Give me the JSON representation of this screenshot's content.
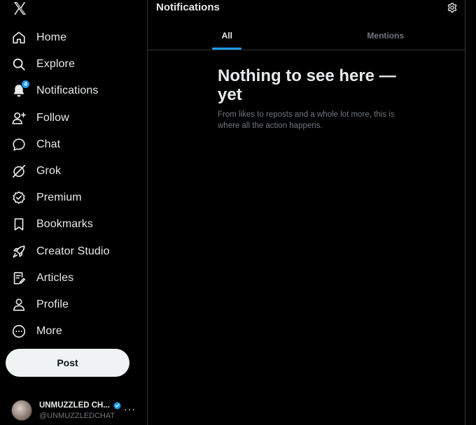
{
  "sidebar": {
    "logo_icon": "x-logo-icon",
    "items": [
      {
        "label": "Home",
        "icon": "home-icon"
      },
      {
        "label": "Explore",
        "icon": "search-icon"
      },
      {
        "label": "Notifications",
        "icon": "bell-icon",
        "badge": "4"
      },
      {
        "label": "Follow",
        "icon": "person-add-icon"
      },
      {
        "label": "Chat",
        "icon": "chat-icon"
      },
      {
        "label": "Grok",
        "icon": "grok-icon"
      },
      {
        "label": "Premium",
        "icon": "premium-icon"
      },
      {
        "label": "Bookmarks",
        "icon": "bookmark-icon"
      },
      {
        "label": "Creator Studio",
        "icon": "rocket-icon"
      },
      {
        "label": "Articles",
        "icon": "article-icon"
      },
      {
        "label": "Profile",
        "icon": "person-icon"
      },
      {
        "label": "More",
        "icon": "more-circle-icon"
      }
    ],
    "post_label": "Post",
    "account": {
      "name": "UNMUZZLED CH...",
      "handle": "@UNMUZZLEDCHAT",
      "more": "···"
    }
  },
  "main": {
    "title": "Notifications",
    "tabs": [
      {
        "label": "All",
        "active": true
      },
      {
        "label": "Mentions",
        "active": false
      }
    ],
    "empty": {
      "title": "Nothing to see here — yet",
      "body": "From likes to reposts and a whole lot more, this is where all the action happens."
    }
  },
  "colors": {
    "background": "#000000",
    "accent": "#1d9bf0",
    "text": "#e7e9ea",
    "muted": "#71767b",
    "border": "#2f3336"
  }
}
